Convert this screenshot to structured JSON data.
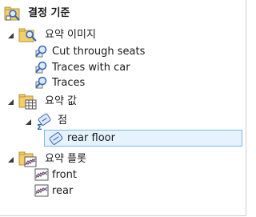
{
  "tree": {
    "root": {
      "label": "결정 기준",
      "icon": "criteria-folder-icon"
    },
    "groups": [
      {
        "label": "요약 이미지",
        "icon": "image-folder-icon",
        "expander": "expanded",
        "items": [
          {
            "label": "Cut through seats",
            "icon": "search-image-icon"
          },
          {
            "label": "Traces with car",
            "icon": "search-image-icon"
          },
          {
            "label": "Traces",
            "icon": "search-image-icon"
          }
        ]
      },
      {
        "label": "요약 값",
        "icon": "table-folder-icon",
        "expander": "expanded",
        "subgroup": {
          "label": "점",
          "icon": "point-sum-icon",
          "expander": "expanded",
          "items": [
            {
              "label": "rear floor",
              "icon": "point-item-icon",
              "selected": true
            }
          ]
        }
      },
      {
        "label": "요약 플롯",
        "icon": "plot-folder-icon",
        "expander": "expanded",
        "items": [
          {
            "label": "front",
            "icon": "plot-item-icon"
          },
          {
            "label": "rear",
            "icon": "plot-item-icon"
          }
        ]
      }
    ]
  },
  "colors": {
    "selection_fill": "#e6f3fd",
    "selection_border": "#7db7e8",
    "folder": "#f3cf6a",
    "icon_blue": "#2f66b8"
  }
}
